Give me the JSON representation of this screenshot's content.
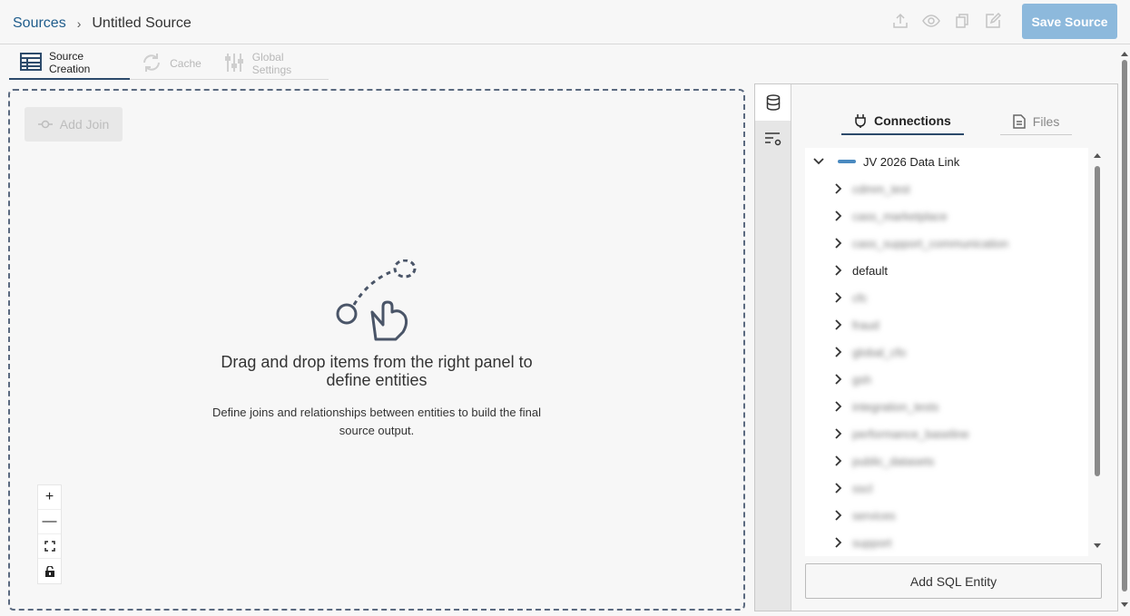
{
  "breadcrumb": {
    "root": "Sources",
    "separator": "›",
    "current": "Untitled Source"
  },
  "toolbar": {
    "icons": [
      "export-icon",
      "eye-icon",
      "copy-icon",
      "edit-icon"
    ],
    "save_label": "Save Source"
  },
  "tabs": [
    {
      "label": "Source Creation",
      "active": true,
      "icon": "table-icon"
    },
    {
      "label": "Cache",
      "active": false,
      "icon": "refresh-icon"
    },
    {
      "label": "Global Settings",
      "active": false,
      "icon": "sliders-icon"
    }
  ],
  "canvas": {
    "add_join_label": "Add Join",
    "empty_title_line1": "Drag and drop items from the right panel to",
    "empty_title_line2": "define entities",
    "empty_sub_line1": "Define joins and relationships between entities to build the final",
    "empty_sub_line2": "source output.",
    "zoom": {
      "in": "+",
      "out": "—"
    }
  },
  "right_panel": {
    "tabs": [
      {
        "label": "Connections",
        "active": true,
        "icon": "plug-icon"
      },
      {
        "label": "Files",
        "active": false,
        "icon": "file-icon"
      }
    ],
    "connection": {
      "name": "JV 2026 Data Link",
      "expanded": true
    },
    "schemas": [
      {
        "label": "cdmm_test",
        "blurred": true
      },
      {
        "label": "cass_marketplace",
        "blurred": true
      },
      {
        "label": "cass_support_communication",
        "blurred": true
      },
      {
        "label": "default",
        "blurred": false
      },
      {
        "label": "cfc",
        "blurred": true
      },
      {
        "label": "fraud",
        "blurred": true
      },
      {
        "label": "global_cfo",
        "blurred": true
      },
      {
        "label": "gsh",
        "blurred": true
      },
      {
        "label": "integration_tests",
        "blurred": true
      },
      {
        "label": "performance_baseline",
        "blurred": true
      },
      {
        "label": "public_datasets",
        "blurred": true
      },
      {
        "label": "sscl",
        "blurred": true
      },
      {
        "label": "services",
        "blurred": true
      },
      {
        "label": "support",
        "blurred": true
      }
    ],
    "add_sql_label": "Add SQL Entity"
  },
  "colors": {
    "accent": "#2c4a6b",
    "link": "#1f5d8c",
    "save_button": "#8db9dc",
    "canvas_border": "#5b6a80"
  }
}
